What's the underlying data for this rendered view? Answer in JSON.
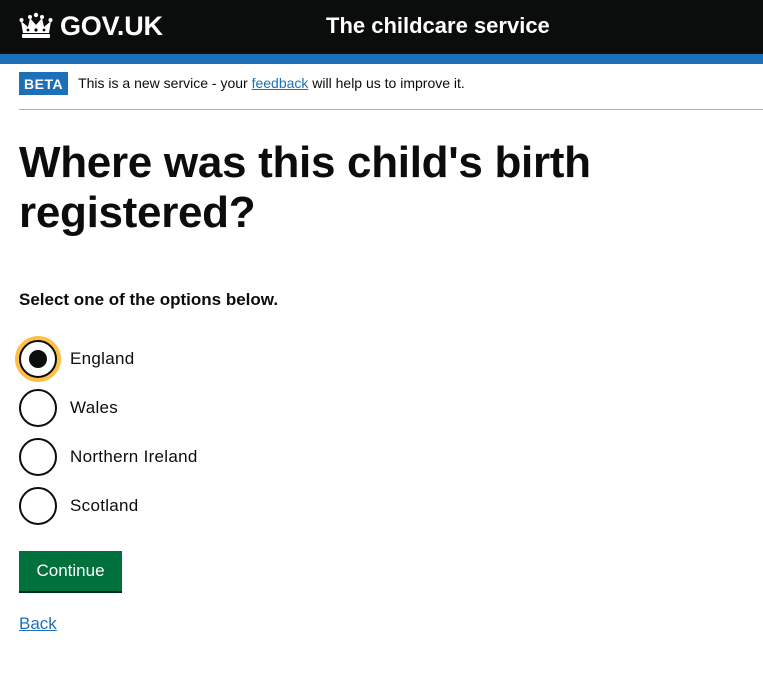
{
  "header": {
    "logo_text": "GOV.UK",
    "service_name": "The childcare service"
  },
  "phase_banner": {
    "tag": "BETA",
    "text_before": "This is a new service - your ",
    "link_text": "feedback",
    "text_after": " will help us to improve it."
  },
  "main": {
    "heading": "Where was this child's birth registered?",
    "hint": "Select one of the options below.",
    "options": [
      {
        "label": "England",
        "selected": true
      },
      {
        "label": "Wales",
        "selected": false
      },
      {
        "label": "Northern Ireland",
        "selected": false
      },
      {
        "label": "Scotland",
        "selected": false
      }
    ],
    "continue_label": "Continue",
    "back_label": "Back"
  },
  "colors": {
    "header_bg": "#0b0c0c",
    "brand_blue": "#1d70b8",
    "button_green": "#00703c",
    "focus_yellow": "#ffbf47",
    "link_blue": "#1d70b8"
  },
  "icons": {
    "logo": "crown-icon"
  }
}
